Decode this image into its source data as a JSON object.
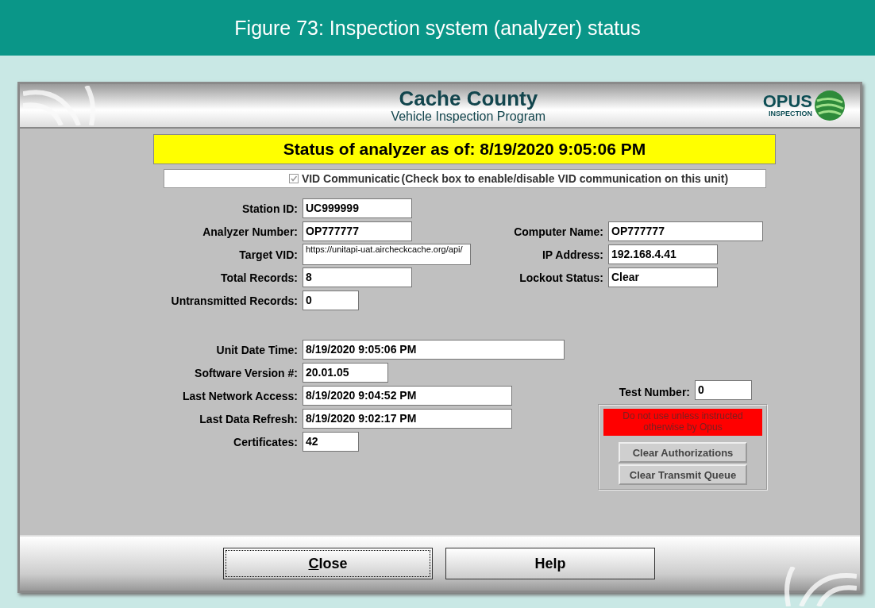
{
  "figure": {
    "caption": "Figure 73: Inspection system (analyzer) status"
  },
  "window": {
    "title": "Cache County",
    "subtitle": "Vehicle Inspection Program",
    "logo": {
      "name": "OPUS",
      "tagline": "INSPECTION"
    }
  },
  "status_banner": "Status of analyzer as of: 8/19/2020 9:05:06 PM",
  "vid_option": {
    "label": "VID Communicatic",
    "checked": true,
    "disabled": true,
    "hint": "(Check box to enable/disable VID communication on this unit)"
  },
  "unit_fields": [
    {
      "label": "Station ID:",
      "value": "UC999999"
    },
    {
      "label": "Analyzer Number:",
      "value": "OP777777"
    },
    {
      "label": "Target VID:",
      "value": "https://unitapi-uat.aircheckcache.org/api/"
    },
    {
      "label": "Total Records:",
      "value": "8"
    },
    {
      "label": "Untransmitted Records:",
      "value": "0"
    }
  ],
  "network_fields": [
    {
      "label": "Computer Name:",
      "value": "OP777777"
    },
    {
      "label": "IP Address:",
      "value": "192.168.4.41"
    },
    {
      "label": "Lockout Status:",
      "value": "Clear"
    }
  ],
  "time_fields": [
    {
      "label": "Unit Date Time:",
      "value": "8/19/2020 9:05:06 PM"
    },
    {
      "label": "Software Version #:",
      "value": "20.01.05"
    },
    {
      "label": "Last Network Access:",
      "value": "8/19/2020 9:04:52 PM"
    },
    {
      "label": "Last Data Refresh:",
      "value": "8/19/2020 9:02:17 PM"
    },
    {
      "label": "Certificates:",
      "value": "42"
    }
  ],
  "test_number": {
    "label": "Test Number:",
    "value": "0"
  },
  "maintenance": {
    "warning": "Do not use unless instructed otherwise by Opus",
    "buttons": [
      "Clear Authorizations",
      "Clear Transmit Queue"
    ]
  },
  "buttons": [
    {
      "label": "Close",
      "focused": true
    },
    {
      "label": "Help",
      "focused": false
    }
  ]
}
